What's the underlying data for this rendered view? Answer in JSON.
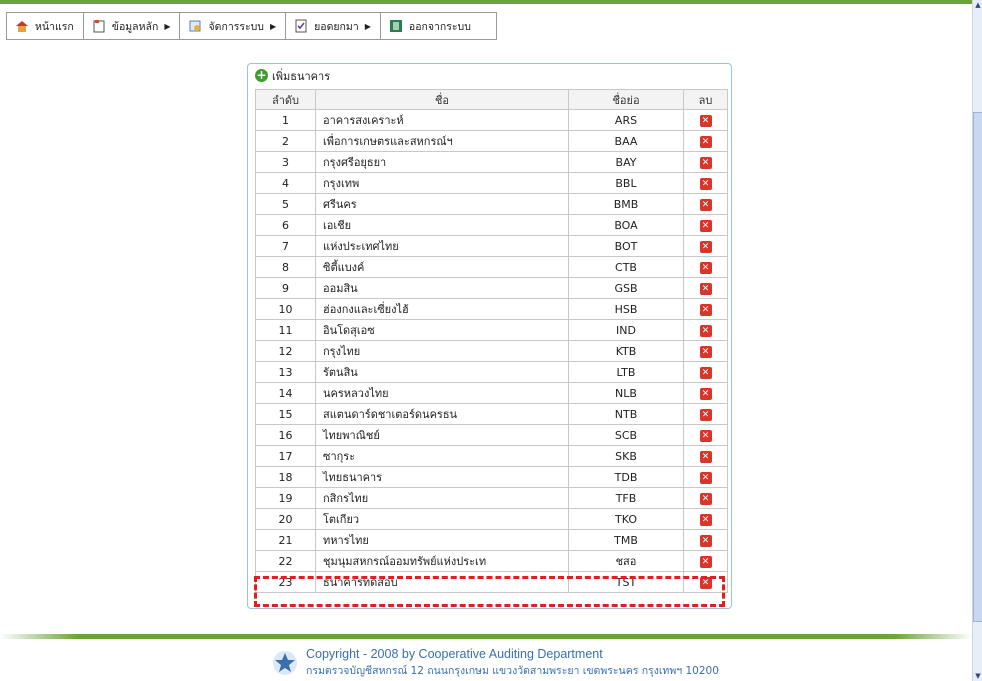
{
  "menu": [
    {
      "label": "หน้าแรก",
      "icon": "home-icon",
      "arrow": ""
    },
    {
      "label": "ข้อมูลหลัก",
      "icon": "folder-icon",
      "arrow": "▶"
    },
    {
      "label": "จัดการระบบ",
      "icon": "settings-icon",
      "arrow": "▶"
    },
    {
      "label": "ยอดยกมา",
      "icon": "checklist-icon",
      "arrow": "▶"
    },
    {
      "label": "ออกจากระบบ",
      "icon": "exit-icon",
      "arrow": ""
    }
  ],
  "panel": {
    "add_label": "เพิ่มธนาคาร",
    "columns": [
      "ลำดับ",
      "ชื่อ",
      "ชื่อย่อ",
      "ลบ"
    ],
    "rows": [
      {
        "no": "1",
        "name": "อาคารสงเคราะห์",
        "abbr": "ARS"
      },
      {
        "no": "2",
        "name": "เพื่อการเกษตรและสหกรณ์ฯ",
        "abbr": "BAA"
      },
      {
        "no": "3",
        "name": "กรุงศรีอยุธยา",
        "abbr": "BAY"
      },
      {
        "no": "4",
        "name": "กรุงเทพ",
        "abbr": "BBL"
      },
      {
        "no": "5",
        "name": "ศรีนคร",
        "abbr": "BMB"
      },
      {
        "no": "6",
        "name": "เอเชีย",
        "abbr": "BOA"
      },
      {
        "no": "7",
        "name": "แห่งประเทศไทย",
        "abbr": "BOT"
      },
      {
        "no": "8",
        "name": "ซิตี้แบงค์",
        "abbr": "CTB"
      },
      {
        "no": "9",
        "name": "ออมสิน",
        "abbr": "GSB"
      },
      {
        "no": "10",
        "name": "ฮ่องกงและเซี่ยงไฮ้",
        "abbr": "HSB"
      },
      {
        "no": "11",
        "name": "อินโดสุเอซ",
        "abbr": "IND"
      },
      {
        "no": "12",
        "name": "กรุงไทย",
        "abbr": "KTB"
      },
      {
        "no": "13",
        "name": "รัตนสิน",
        "abbr": "LTB"
      },
      {
        "no": "14",
        "name": "นครหลวงไทย",
        "abbr": "NLB"
      },
      {
        "no": "15",
        "name": "สแตนดาร์ดชาเตอร์ดนครธน",
        "abbr": "NTB"
      },
      {
        "no": "16",
        "name": "ไทยพาณิชย์",
        "abbr": "SCB"
      },
      {
        "no": "17",
        "name": "ซากุระ",
        "abbr": "SKB"
      },
      {
        "no": "18",
        "name": "ไทยธนาคาร",
        "abbr": "TDB"
      },
      {
        "no": "19",
        "name": "กสิกรไทย",
        "abbr": "TFB"
      },
      {
        "no": "20",
        "name": "โตเกียว",
        "abbr": "TKO"
      },
      {
        "no": "21",
        "name": "ทหารไทย",
        "abbr": "TMB"
      },
      {
        "no": "22",
        "name": "ชุมนุมสหกรณ์ออมทรัพย์แห่งประเท",
        "abbr": "ชสอ"
      },
      {
        "no": "23",
        "name": "ธนาคารทดสอบ",
        "abbr": "TST"
      }
    ]
  },
  "footer": {
    "copyright": "Copyright - 2008 by Cooperative Auditing Department",
    "address": "กรมตรวจบัญชีสหกรณ์ 12 ถนนกรุงเกษม แขวงวัดสามพระยา เขตพระนคร กรุงเทพฯ 10200"
  },
  "colors": {
    "accent_green": "#6aa33a",
    "link_blue": "#3a6fb0",
    "delete_red": "#d9352a",
    "highlight_red": "#e02020"
  }
}
